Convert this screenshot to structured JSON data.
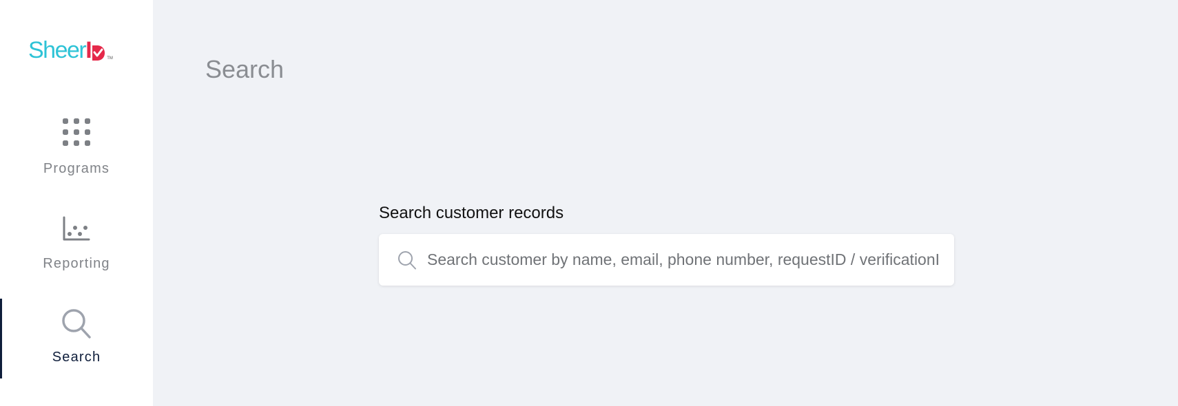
{
  "brand": {
    "logo_text": "SheerID",
    "accent": "#2ec3d6",
    "brand_red": "#e5294a"
  },
  "sidebar": {
    "items": [
      {
        "label": "Programs",
        "icon": "grid-icon",
        "active": false
      },
      {
        "label": "Reporting",
        "icon": "scatter-chart-icon",
        "active": false
      },
      {
        "label": "Search",
        "icon": "search-icon",
        "active": true
      }
    ],
    "active_color": "#0f1e3b"
  },
  "main": {
    "title": "Search",
    "search": {
      "label": "Search customer records",
      "placeholder": "Search customer by name, email, phone number, requestID / verificationID",
      "value": ""
    }
  }
}
